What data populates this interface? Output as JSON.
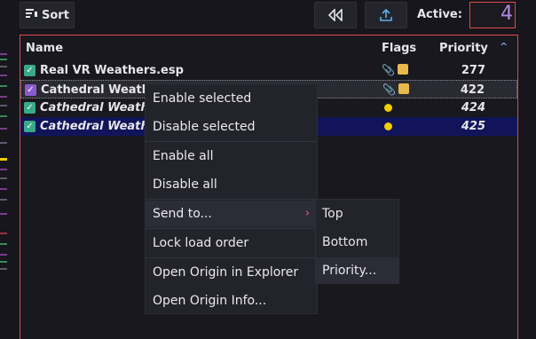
{
  "toolbar": {
    "sort_label": "Sort",
    "active_label": "Active:",
    "active_value": "4"
  },
  "table": {
    "columns": {
      "name": "Name",
      "flags": "Flags",
      "priority": "Priority"
    },
    "rows": [
      {
        "name": "Real VR Weathers.esp",
        "priority": "277",
        "checked": true,
        "italic": false,
        "flags": [
          "paperclip-icon",
          "package-icon"
        ]
      },
      {
        "name": "Cathedral Weathe",
        "priority": "422",
        "checked": true,
        "italic": false,
        "flags": [
          "paperclip-icon",
          "package-icon"
        ]
      },
      {
        "name": "Cathedral Weather",
        "priority": "424",
        "checked": true,
        "italic": true,
        "flags": [
          "yellow-dot-icon"
        ]
      },
      {
        "name": "Cathedral Weather",
        "priority": "425",
        "checked": true,
        "italic": true,
        "flags": [
          "yellow-dot-icon"
        ]
      }
    ]
  },
  "context_menu": {
    "items": [
      "Enable selected",
      "Disable selected",
      "Enable all",
      "Disable all",
      "Send to...",
      "Lock load order",
      "Open Origin in Explorer",
      "Open Origin Info..."
    ],
    "submenu": [
      "Top",
      "Bottom",
      "Priority..."
    ]
  },
  "colors": {
    "accent_border": "#e0484c",
    "checkbox_green": "#3aa98a",
    "checkbox_purple": "#8a5bd0",
    "selected_row": "#12145a",
    "flag_yellow": "#f2d000"
  }
}
